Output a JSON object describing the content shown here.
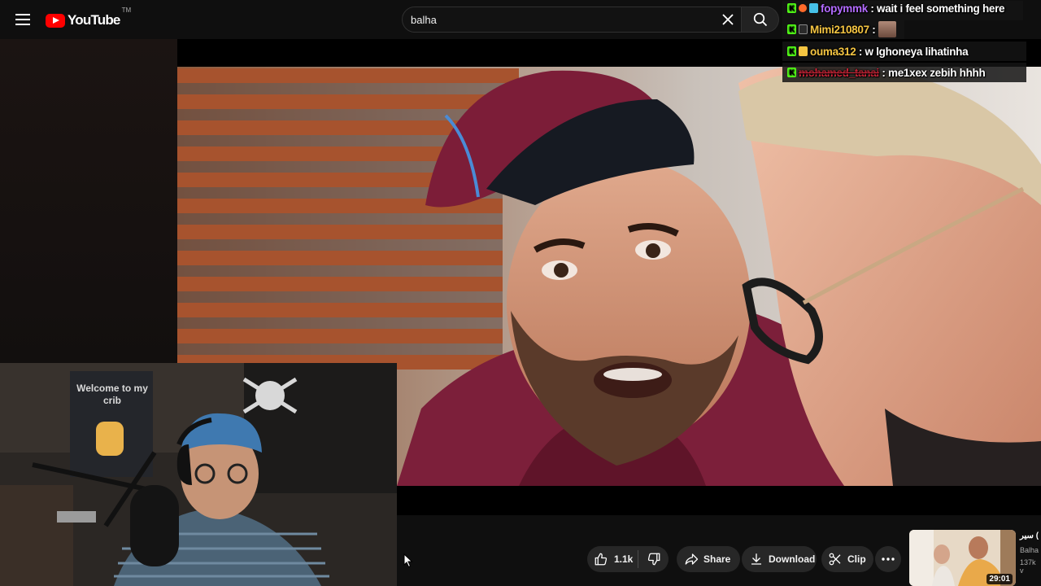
{
  "header": {
    "logo_text": "YouTube",
    "logo_tm": "TM",
    "search_value": "balha",
    "icons": {
      "menu": "hamburger-menu-icon",
      "clear": "close-icon",
      "search": "search-icon"
    }
  },
  "webcam": {
    "poster_text": "Welcome to my crib"
  },
  "actions": {
    "like_count": "1.1k",
    "share_label": "Share",
    "download_label": "Download",
    "clip_label": "Clip",
    "icons": {
      "like": "thumbs-up-icon",
      "dislike": "thumbs-down-icon",
      "share": "share-arrow-icon",
      "download": "download-icon",
      "clip": "scissors-icon",
      "more": "more-horizontal-icon"
    }
  },
  "suggested": {
    "title": "سير (",
    "channel": "Balha",
    "views": "137k v",
    "duration": "29:01"
  },
  "chat": {
    "messages": [
      {
        "user": "fopymmk",
        "separator": " : ",
        "text": "wait i feel something here",
        "user_color": "#b36bff"
      },
      {
        "user": "Mimi210807",
        "separator": " : ",
        "text": "",
        "user_color": "#f5c542",
        "has_emote": true
      },
      {
        "user": "ouma312",
        "separator": " : ",
        "text": "w lghoneya lihatinha",
        "user_color": "#f5c542"
      },
      {
        "user": "mohamed_tanai",
        "separator": " : ",
        "text": "me1xex zebih hhhh",
        "user_color": "#d4263a"
      }
    ]
  },
  "colors": {
    "brand": "#ff0000",
    "kick_badge": "#53fc18",
    "pill_bg": "#272727"
  }
}
